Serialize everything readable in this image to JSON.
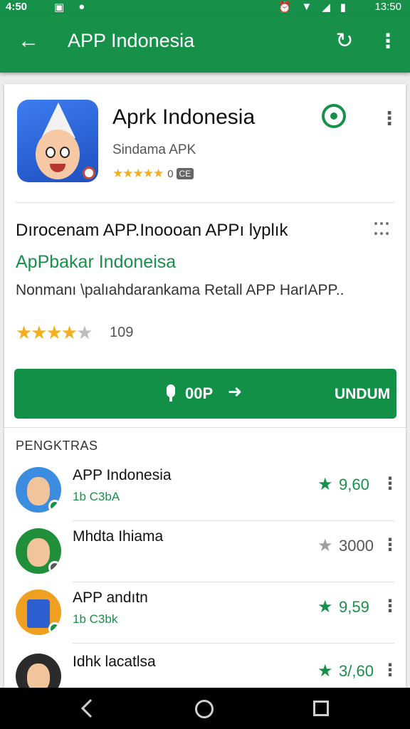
{
  "status_bar": {
    "time_left": "4:50",
    "time_right": "13:50"
  },
  "app_bar": {
    "title": "APP Indonesia"
  },
  "app_header": {
    "title": "Aprk Indonesia",
    "developer": "Sindama APK",
    "rating_count": "0",
    "badge": "CE"
  },
  "description": {
    "title": "Dırocenam APP.Inoooan APPı lyplık",
    "subtitle": "ApPbakar Indoneisa",
    "body": "Nonmanı \\palıahdarankama Retall APP HarIAPP..",
    "rating_value": 4,
    "rating_count": "109"
  },
  "install": {
    "size": "00P",
    "label": "UNDUM"
  },
  "related": {
    "title": "PENGKTRAS",
    "items": [
      {
        "name": "APP Indonesia",
        "sub": "1b C3bA",
        "score": "9,60",
        "star_color": "#17914a",
        "score_color": "#17914a"
      },
      {
        "name": "Mhdta Ihiama",
        "sub": "",
        "score": "3000",
        "star_color": "#9e9e9e",
        "score_color": "#555555"
      },
      {
        "name": "APP andıtn",
        "sub": "1b C3bk",
        "score": "9,59",
        "star_color": "#17914a",
        "score_color": "#17914a"
      },
      {
        "name": "Idhk lacatlsa",
        "sub": "",
        "score": "3/,60",
        "star_color": "#17914a",
        "score_color": "#17914a"
      }
    ]
  },
  "colors": {
    "brand_green": "#17914a",
    "star_yellow": "#f2b01e"
  }
}
